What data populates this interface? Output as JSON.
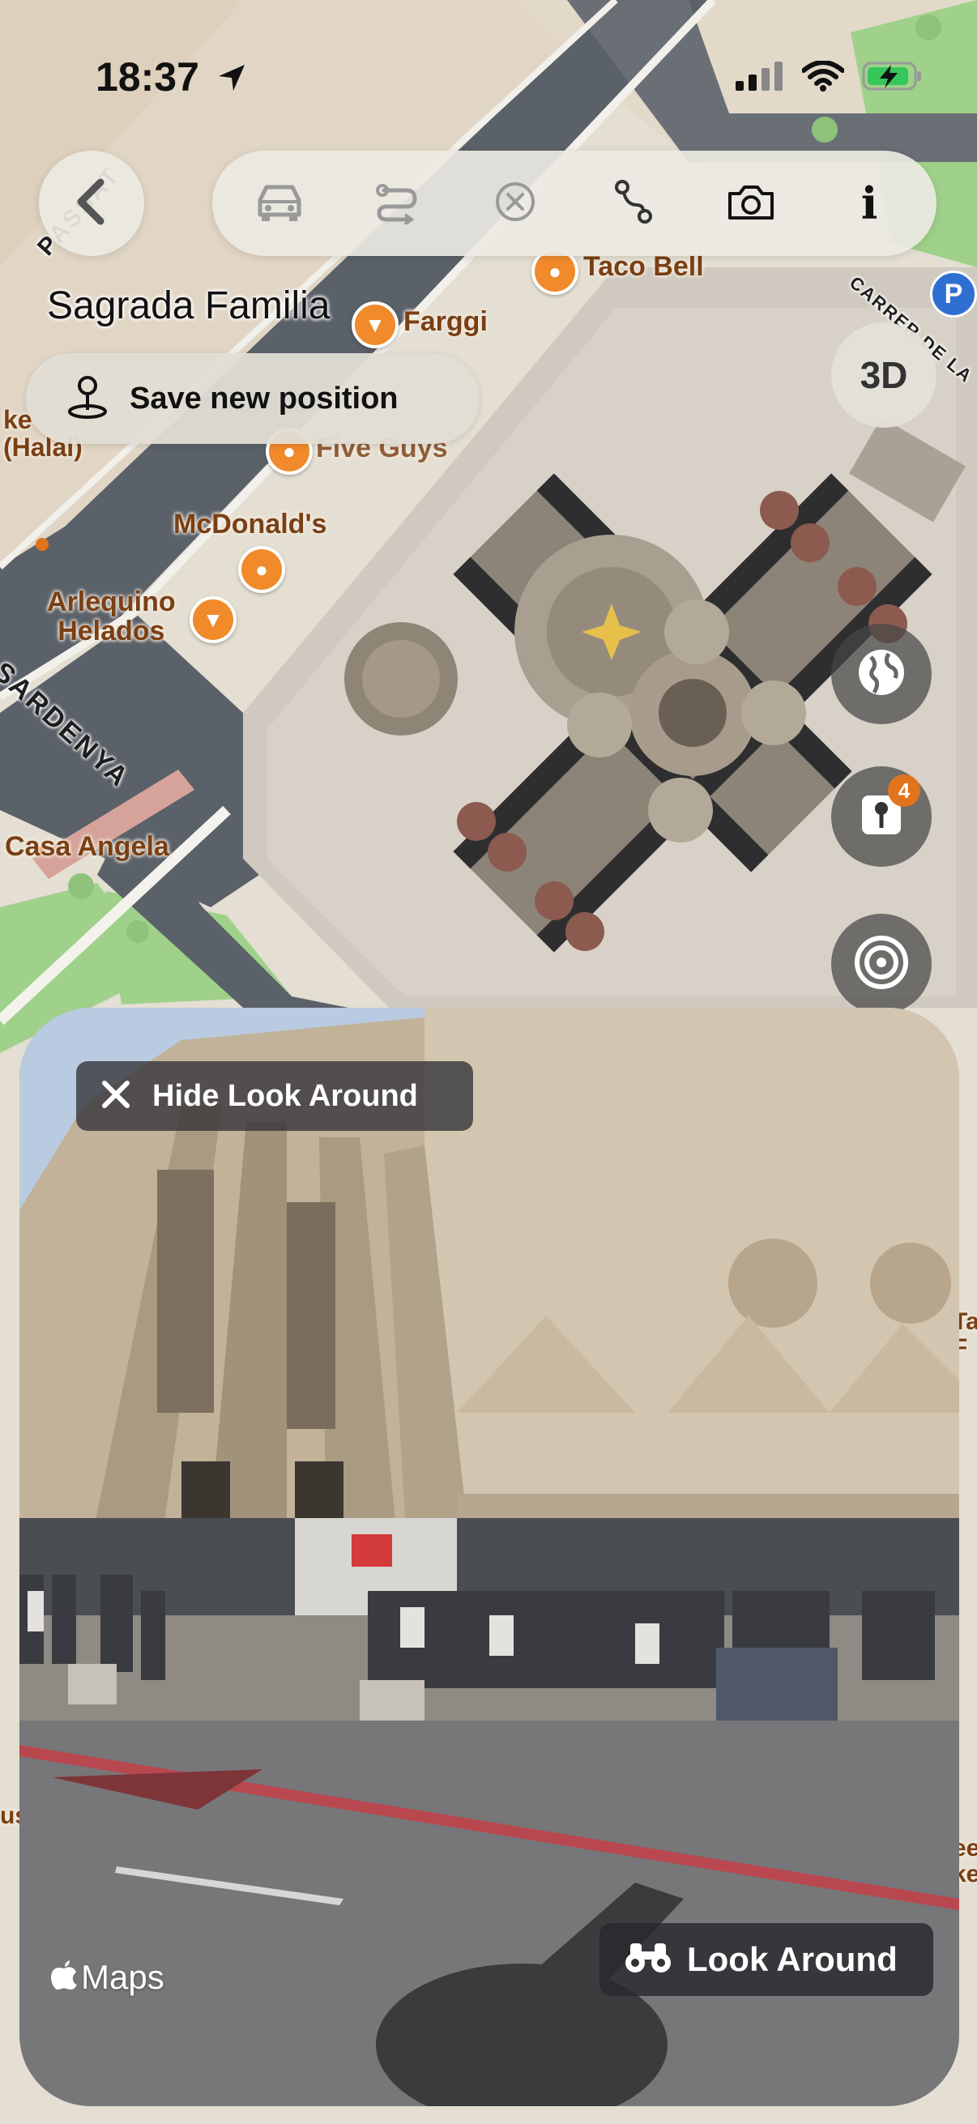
{
  "status_bar": {
    "time": "18:37",
    "icons": [
      "location-arrow-icon",
      "signal-bars-icon",
      "wifi-icon",
      "battery-charging-icon"
    ]
  },
  "toolbar": {
    "tools": [
      "car-icon",
      "route-icon",
      "close-circle-icon",
      "path-icon",
      "camera-icon",
      "info-icon"
    ],
    "info_label": "i"
  },
  "place": {
    "title": "Sagrada Familia"
  },
  "save_button": {
    "label": "Save new position"
  },
  "map": {
    "pois": [
      {
        "name": "Taco Bell"
      },
      {
        "name": "Farggi"
      },
      {
        "name": "Five Guys"
      },
      {
        "name": "McDonald's"
      },
      {
        "name": "Arlequino\nHelados"
      },
      {
        "name": "Casa Angela"
      },
      {
        "name": "ke\n(Halal)"
      }
    ],
    "streets": [
      "PASSAT",
      "SARDENYA",
      "CARRER DE LA"
    ],
    "parking_label": "P",
    "edge_labels": [
      "Ta\nF",
      "us",
      "ee\nke"
    ]
  },
  "controls": {
    "btn_3d": "3D",
    "pins_badge": "4",
    "icons": [
      "globe-icon",
      "pins-icon",
      "target-icon"
    ]
  },
  "look_around": {
    "hide_label": "Hide Look Around",
    "action_label": "Look Around",
    "brand": "Maps"
  },
  "colors": {
    "map_land": "#e6e2d6",
    "road": "#c9c6bc",
    "dark_road": "#5b6169",
    "park": "#9fd18a",
    "poi_orange": "#f08a2b",
    "poi_text": "#7a3f14"
  }
}
